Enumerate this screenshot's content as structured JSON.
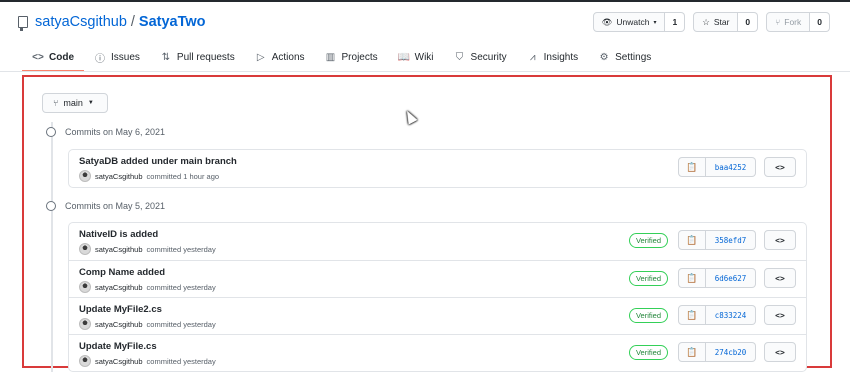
{
  "repo": {
    "owner": "satyaCsgithub",
    "separator": "/",
    "name": "SatyaTwo"
  },
  "header_actions": [
    {
      "label": "Unwatch",
      "icon": "eye-icon",
      "count": "1"
    },
    {
      "label": "Star",
      "icon": "star-icon",
      "count": "0"
    },
    {
      "label": "Fork",
      "icon": "fork-icon",
      "count": "0"
    }
  ],
  "tabs": [
    {
      "label": "Code",
      "icon": "code-icon",
      "active": true
    },
    {
      "label": "Issues",
      "icon": "issue-icon"
    },
    {
      "label": "Pull requests",
      "icon": "pull-request-icon"
    },
    {
      "label": "Actions",
      "icon": "play-icon"
    },
    {
      "label": "Projects",
      "icon": "project-icon"
    },
    {
      "label": "Wiki",
      "icon": "book-icon"
    },
    {
      "label": "Security",
      "icon": "shield-icon"
    },
    {
      "label": "Insights",
      "icon": "graph-icon"
    },
    {
      "label": "Settings",
      "icon": "gear-icon"
    }
  ],
  "branch": "main",
  "days": [
    {
      "heading": "Commits on May 6, 2021",
      "commits": [
        {
          "message": "SatyaDB added under main branch",
          "author": "satyaCsgithub",
          "action": "committed 1 hour ago",
          "verified": "",
          "sha": "baa4252"
        }
      ]
    },
    {
      "heading": "Commits on May 5, 2021",
      "commits": [
        {
          "message": "NativeID is added",
          "author": "satyaCsgithub",
          "action": "committed yesterday",
          "verified": "Verified",
          "sha": "358efd7"
        },
        {
          "message": "Comp Name added",
          "author": "satyaCsgithub",
          "action": "committed yesterday",
          "verified": "Verified",
          "sha": "6d6e627"
        },
        {
          "message": "Update MyFile2.cs",
          "author": "satyaCsgithub",
          "action": "committed yesterday",
          "verified": "Verified",
          "sha": "c833224"
        },
        {
          "message": "Update MyFile.cs",
          "author": "satyaCsgithub",
          "action": "committed yesterday",
          "verified": "Verified",
          "sha": "274cb20"
        }
      ]
    }
  ],
  "browse_label": "<>",
  "colors": {
    "link": "#0366d6",
    "active_tab": "#f9826c",
    "verified": "#22863a",
    "highlight": "#d93a3a"
  }
}
